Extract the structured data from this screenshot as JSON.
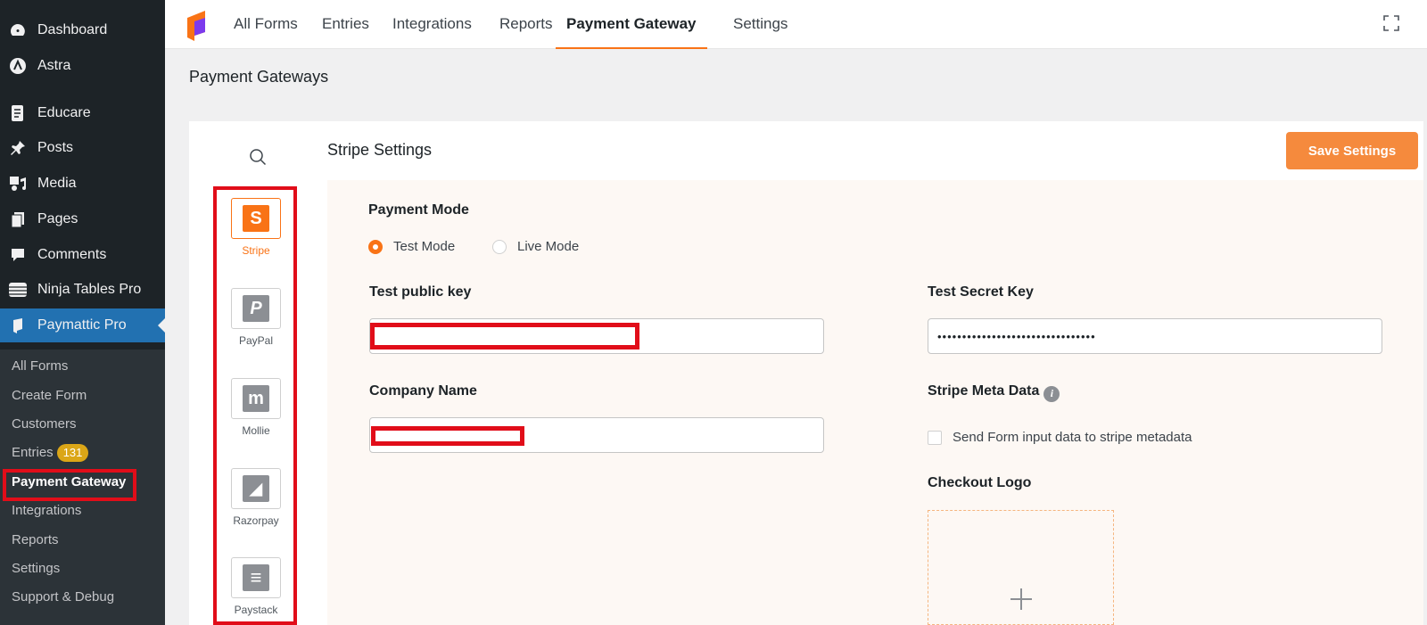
{
  "wp_menu": [
    {
      "label": "Dashboard",
      "icon": "dashboard-icon"
    },
    {
      "label": "Astra",
      "icon": "astra-icon"
    },
    {
      "label": "Educare",
      "icon": "educare-icon"
    },
    {
      "label": "Posts",
      "icon": "pushpin-icon"
    },
    {
      "label": "Media",
      "icon": "media-icon"
    },
    {
      "label": "Pages",
      "icon": "pages-icon"
    },
    {
      "label": "Comments",
      "icon": "comment-icon"
    },
    {
      "label": "Ninja Tables Pro",
      "icon": "table-icon"
    },
    {
      "label": "Paymattic Pro",
      "icon": "paymattic-icon"
    }
  ],
  "submenu": {
    "all_forms": "All Forms",
    "create_form": "Create Form",
    "customers": "Customers",
    "entries": "Entries",
    "entries_count": "131",
    "payment_gateway": "Payment Gateway",
    "integrations": "Integrations",
    "reports": "Reports",
    "settings": "Settings",
    "support": "Support & Debug"
  },
  "topnav": {
    "tabs": [
      "All Forms",
      "Entries",
      "Integrations",
      "Reports",
      "Payment Gateway",
      "Settings"
    ],
    "active": "Payment Gateway"
  },
  "page": {
    "heading": "Payment Gateways"
  },
  "gateways": [
    {
      "label": "Stripe",
      "glyph": "S",
      "active": true
    },
    {
      "label": "PayPal",
      "glyph": "P",
      "active": false
    },
    {
      "label": "Mollie",
      "glyph": "m",
      "active": false
    },
    {
      "label": "Razorpay",
      "glyph": "◢",
      "active": false
    },
    {
      "label": "Paystack",
      "glyph": "≡",
      "active": false
    }
  ],
  "stripe": {
    "title": "Stripe Settings",
    "save_label": "Save Settings",
    "payment_mode_label": "Payment Mode",
    "test_mode_label": "Test Mode",
    "live_mode_label": "Live Mode",
    "selected_mode": "Test Mode",
    "public_key_label": "Test public key",
    "public_key_value": "",
    "secret_key_label": "Test Secret Key",
    "secret_key_value": "••••••••••••••••••••••••••••••••",
    "company_name_label": "Company Name",
    "company_name_value": "",
    "meta_data_label": "Stripe Meta Data",
    "meta_data_checkbox_label": "Send Form input data to stripe metadata",
    "meta_data_checked": false,
    "checkout_logo_label": "Checkout Logo"
  },
  "colors": {
    "accent": "#f97316",
    "wp_sidebar": "#1d2327",
    "wp_active": "#2271b1",
    "annotation_red": "#e10d19"
  }
}
